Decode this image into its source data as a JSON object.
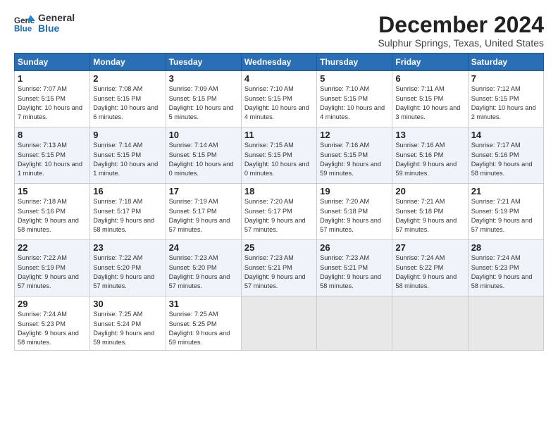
{
  "logo": {
    "general": "General",
    "blue": "Blue"
  },
  "title": "December 2024",
  "subtitle": "Sulphur Springs, Texas, United States",
  "days_header": [
    "Sunday",
    "Monday",
    "Tuesday",
    "Wednesday",
    "Thursday",
    "Friday",
    "Saturday"
  ],
  "weeks": [
    [
      {
        "num": "1",
        "rise": "7:07 AM",
        "set": "5:15 PM",
        "daylight": "10 hours and 7 minutes."
      },
      {
        "num": "2",
        "rise": "7:08 AM",
        "set": "5:15 PM",
        "daylight": "10 hours and 6 minutes."
      },
      {
        "num": "3",
        "rise": "7:09 AM",
        "set": "5:15 PM",
        "daylight": "10 hours and 5 minutes."
      },
      {
        "num": "4",
        "rise": "7:10 AM",
        "set": "5:15 PM",
        "daylight": "10 hours and 4 minutes."
      },
      {
        "num": "5",
        "rise": "7:10 AM",
        "set": "5:15 PM",
        "daylight": "10 hours and 4 minutes."
      },
      {
        "num": "6",
        "rise": "7:11 AM",
        "set": "5:15 PM",
        "daylight": "10 hours and 3 minutes."
      },
      {
        "num": "7",
        "rise": "7:12 AM",
        "set": "5:15 PM",
        "daylight": "10 hours and 2 minutes."
      }
    ],
    [
      {
        "num": "8",
        "rise": "7:13 AM",
        "set": "5:15 PM",
        "daylight": "10 hours and 1 minute."
      },
      {
        "num": "9",
        "rise": "7:14 AM",
        "set": "5:15 PM",
        "daylight": "10 hours and 1 minute."
      },
      {
        "num": "10",
        "rise": "7:14 AM",
        "set": "5:15 PM",
        "daylight": "10 hours and 0 minutes."
      },
      {
        "num": "11",
        "rise": "7:15 AM",
        "set": "5:15 PM",
        "daylight": "10 hours and 0 minutes."
      },
      {
        "num": "12",
        "rise": "7:16 AM",
        "set": "5:15 PM",
        "daylight": "9 hours and 59 minutes."
      },
      {
        "num": "13",
        "rise": "7:16 AM",
        "set": "5:16 PM",
        "daylight": "9 hours and 59 minutes."
      },
      {
        "num": "14",
        "rise": "7:17 AM",
        "set": "5:16 PM",
        "daylight": "9 hours and 58 minutes."
      }
    ],
    [
      {
        "num": "15",
        "rise": "7:18 AM",
        "set": "5:16 PM",
        "daylight": "9 hours and 58 minutes."
      },
      {
        "num": "16",
        "rise": "7:18 AM",
        "set": "5:17 PM",
        "daylight": "9 hours and 58 minutes."
      },
      {
        "num": "17",
        "rise": "7:19 AM",
        "set": "5:17 PM",
        "daylight": "9 hours and 57 minutes."
      },
      {
        "num": "18",
        "rise": "7:20 AM",
        "set": "5:17 PM",
        "daylight": "9 hours and 57 minutes."
      },
      {
        "num": "19",
        "rise": "7:20 AM",
        "set": "5:18 PM",
        "daylight": "9 hours and 57 minutes."
      },
      {
        "num": "20",
        "rise": "7:21 AM",
        "set": "5:18 PM",
        "daylight": "9 hours and 57 minutes."
      },
      {
        "num": "21",
        "rise": "7:21 AM",
        "set": "5:19 PM",
        "daylight": "9 hours and 57 minutes."
      }
    ],
    [
      {
        "num": "22",
        "rise": "7:22 AM",
        "set": "5:19 PM",
        "daylight": "9 hours and 57 minutes."
      },
      {
        "num": "23",
        "rise": "7:22 AM",
        "set": "5:20 PM",
        "daylight": "9 hours and 57 minutes."
      },
      {
        "num": "24",
        "rise": "7:23 AM",
        "set": "5:20 PM",
        "daylight": "9 hours and 57 minutes."
      },
      {
        "num": "25",
        "rise": "7:23 AM",
        "set": "5:21 PM",
        "daylight": "9 hours and 57 minutes."
      },
      {
        "num": "26",
        "rise": "7:23 AM",
        "set": "5:21 PM",
        "daylight": "9 hours and 58 minutes."
      },
      {
        "num": "27",
        "rise": "7:24 AM",
        "set": "5:22 PM",
        "daylight": "9 hours and 58 minutes."
      },
      {
        "num": "28",
        "rise": "7:24 AM",
        "set": "5:23 PM",
        "daylight": "9 hours and 58 minutes."
      }
    ],
    [
      {
        "num": "29",
        "rise": "7:24 AM",
        "set": "5:23 PM",
        "daylight": "9 hours and 58 minutes."
      },
      {
        "num": "30",
        "rise": "7:25 AM",
        "set": "5:24 PM",
        "daylight": "9 hours and 59 minutes."
      },
      {
        "num": "31",
        "rise": "7:25 AM",
        "set": "5:25 PM",
        "daylight": "9 hours and 59 minutes."
      },
      null,
      null,
      null,
      null
    ]
  ]
}
